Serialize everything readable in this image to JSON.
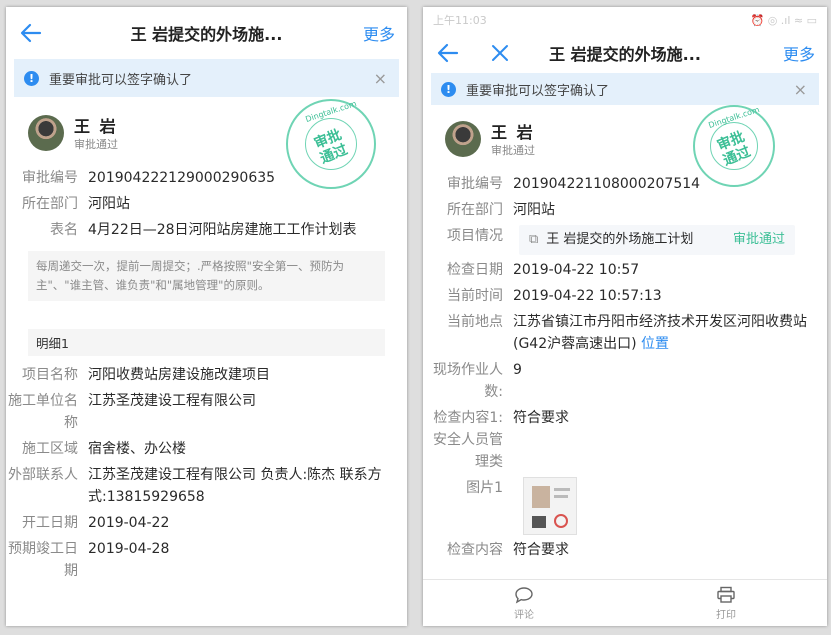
{
  "left": {
    "title": "王 岩提交的外场施...",
    "more": "更多",
    "notice": "重要审批可以签字确认了",
    "close_x": "×",
    "user": {
      "name": "王 岩",
      "status": "审批通过"
    },
    "stamp": {
      "text": "审批\n通过",
      "domain": "Dingtalk.com"
    },
    "fields": [
      {
        "label": "审批编号",
        "value": "201904222129000290635"
      },
      {
        "label": "所在部门",
        "value": "河阳站"
      },
      {
        "label": "表名",
        "value": "4月22日—28日河阳站房建施工工作计划表"
      }
    ],
    "description": "每周递交一次，提前一周提交；.严格按照\"安全第一、预防为主\"、\"谁主管、谁负责\"和\"属地管理\"的原则。",
    "section": "明细1",
    "details": [
      {
        "label": "项目名称",
        "value": "河阳收费站房建设施改建项目"
      },
      {
        "label": "施工单位名称",
        "value": "江苏圣茂建设工程有限公司"
      },
      {
        "label": "施工区域",
        "value": "宿舍楼、办公楼"
      },
      {
        "label": "外部联系人",
        "value": "江苏圣茂建设工程有限公司 负责人:陈杰 联系方式:13815929658"
      },
      {
        "label": "开工日期",
        "value": "2019-04-22"
      },
      {
        "label": "预期竣工日期",
        "value": "2019-04-28"
      }
    ]
  },
  "right": {
    "status_time": "上午11:03",
    "status_icons": "⏰ ◎ .ıl ≈ ▭",
    "title": "王 岩提交的外场施...",
    "more": "更多",
    "notice": "重要审批可以签字确认了",
    "close_x": "×",
    "user": {
      "name": "王 岩",
      "status": "审批通过"
    },
    "stamp": {
      "text": "审批\n通过",
      "domain": "Dingtalk.com"
    },
    "fields": [
      {
        "label": "审批编号",
        "value": "201904221108000207514"
      },
      {
        "label": "所在部门",
        "value": "河阳站"
      }
    ],
    "project": {
      "label": "项目情况",
      "name": "王 岩提交的外场施工计划",
      "status": "审批通过"
    },
    "fields2": [
      {
        "label": "检查日期",
        "value": "2019-04-22 10:57"
      },
      {
        "label": "当前时间",
        "value": "2019-04-22 10:57:13"
      }
    ],
    "location": {
      "label": "当前地点",
      "value": "江苏省镇江市丹阳市经济技术开发区河阳收费站(G42沪蓉高速出口)",
      "link": "位置"
    },
    "fields3": [
      {
        "label": "现场作业人数:",
        "value": "9"
      },
      {
        "label": "检查内容1: 安全人员管理类",
        "value": "符合要求"
      },
      {
        "label": "图片1",
        "value": ""
      },
      {
        "label": "检查内容",
        "value": "符合要求"
      }
    ],
    "bottom": {
      "comment": "评论",
      "print": "打印"
    }
  }
}
